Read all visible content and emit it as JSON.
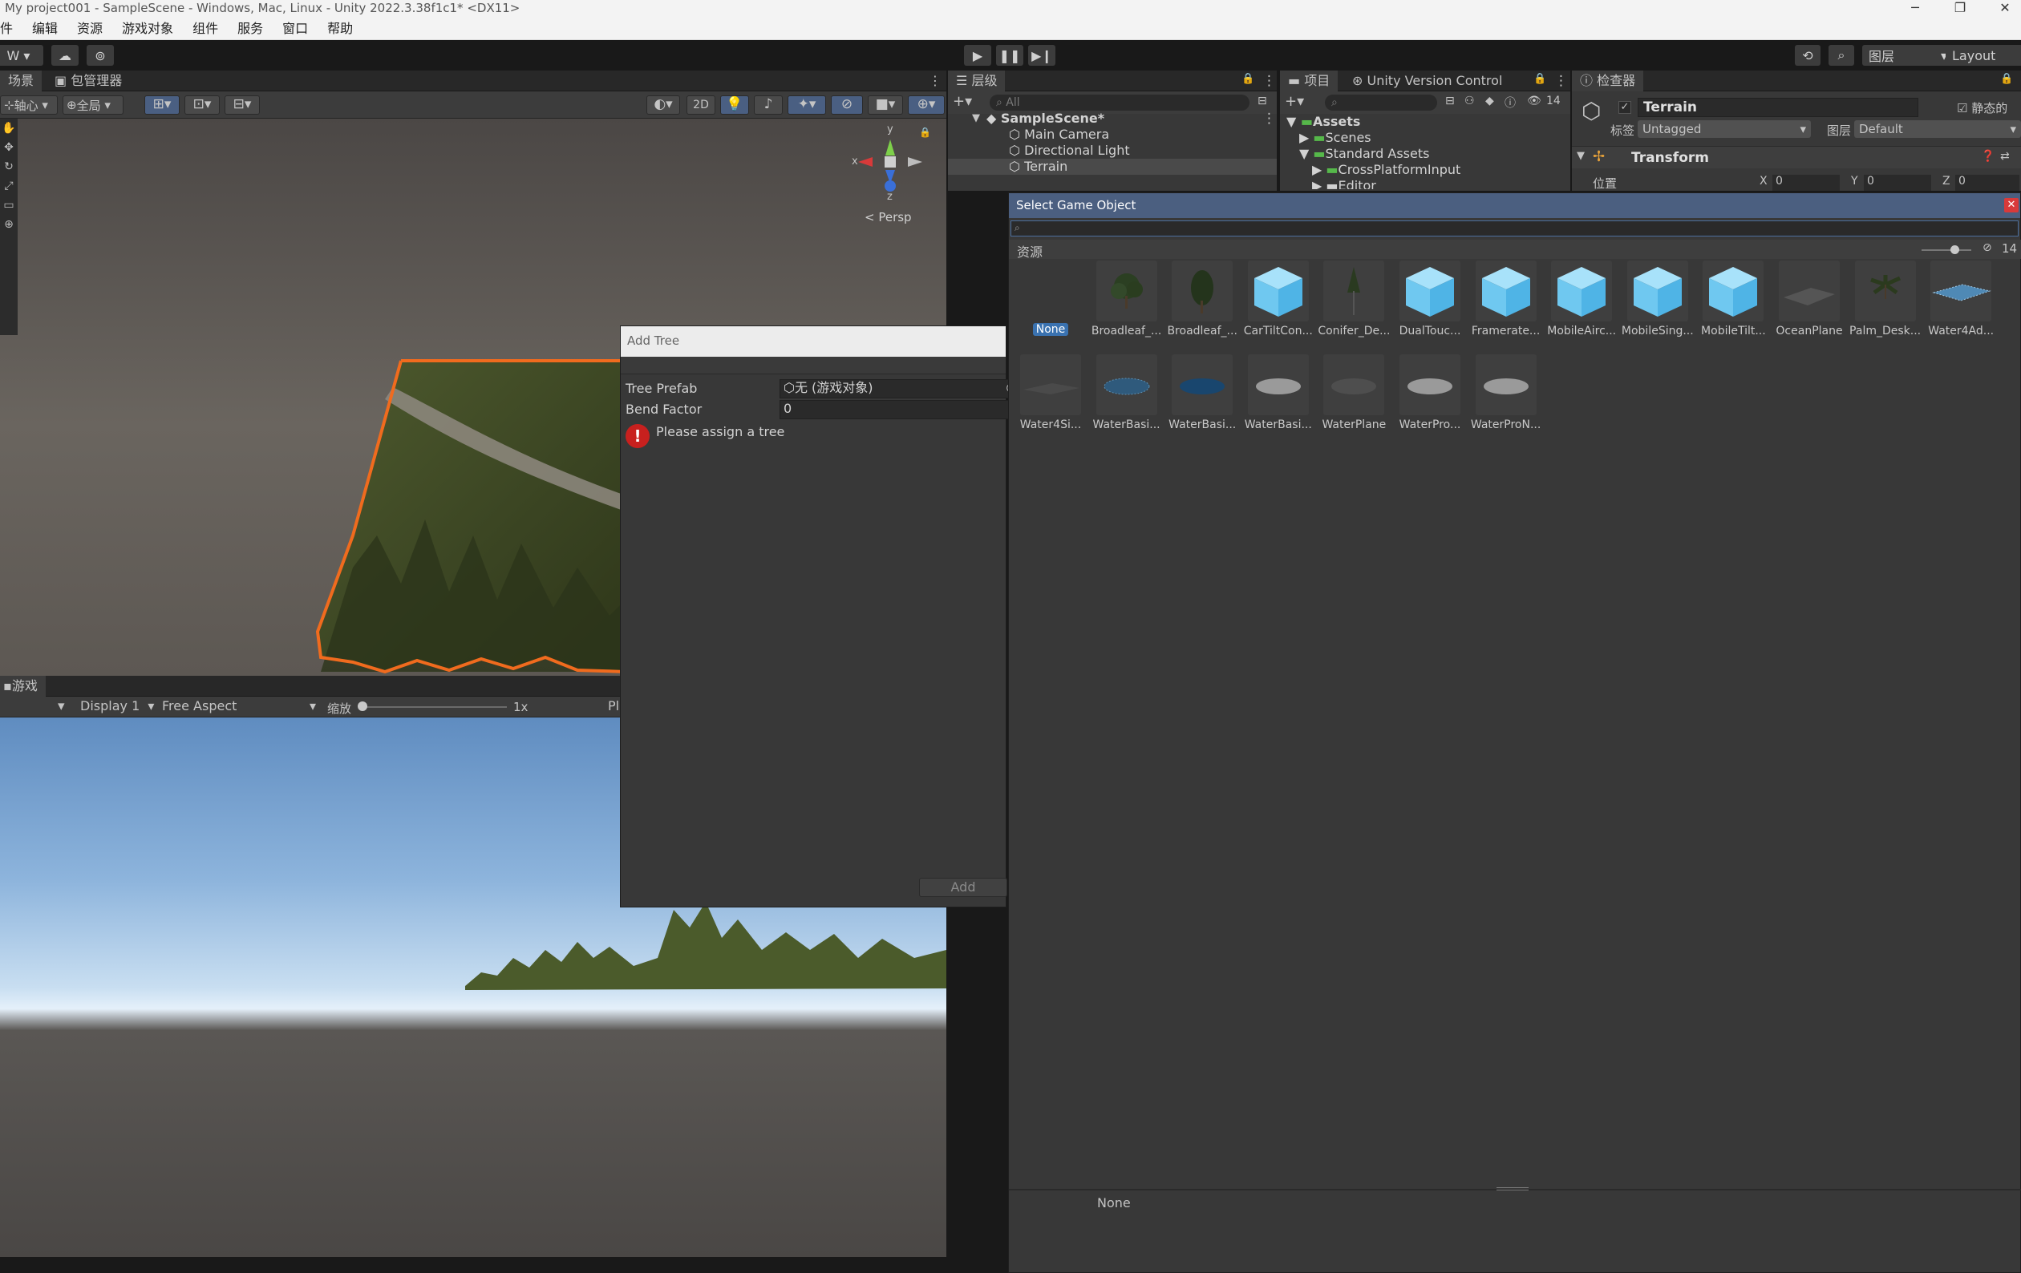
{
  "titlebar": {
    "title": "My project001 - SampleScene - Windows, Mac, Linux - Unity 2022.3.38f1c1* <DX11>"
  },
  "menu": [
    "件",
    "编辑",
    "资源",
    "游戏对象",
    "组件",
    "服务",
    "窗口",
    "帮助"
  ],
  "toolbar": {
    "account": "W",
    "layers_label": "图层",
    "layout_label": "Layout"
  },
  "scene": {
    "tabs": [
      "场景",
      "包管理器"
    ],
    "pivot_label": "轴心",
    "global_label": "全局",
    "mode_2d": "2D",
    "persp_label": "< Persp",
    "gizmo_axes": {
      "x": "x",
      "y": "y",
      "z": "z"
    }
  },
  "game": {
    "tab": "游戏",
    "display": "Display 1",
    "aspect": "Free Aspect",
    "scale_label": "缩放",
    "scale_value": "1x",
    "play_label": "Pl"
  },
  "add_tree": {
    "title": "Add Tree",
    "props": [
      {
        "label": "Tree Prefab",
        "value": "无 (游戏对象)"
      },
      {
        "label": "Bend Factor",
        "value": "0"
      }
    ],
    "warning": "Please assign a tree",
    "add_button": "Add"
  },
  "hierarchy": {
    "tab": "层级",
    "search_placeholder": "All",
    "scene": "SampleScene*",
    "items": [
      "Main Camera",
      "Directional Light",
      "Terrain"
    ]
  },
  "project": {
    "tabs": [
      "项目",
      "Unity Version Control"
    ],
    "count": "14",
    "tree": [
      "Assets",
      "Scenes",
      "Standard Assets",
      "CrossPlatformInput",
      "Editor"
    ]
  },
  "inspector": {
    "tab": "检查器",
    "object_name": "Terrain",
    "static_label": "静态的",
    "tag_label": "标签",
    "tag_value": "Untagged",
    "layer_label": "图层",
    "layer_value": "Default",
    "component": "Transform",
    "position_label": "位置",
    "axis_labels": [
      "X",
      "Y",
      "Z"
    ],
    "axis_values": [
      "0",
      "0",
      "0"
    ]
  },
  "select_go": {
    "title": "Select Game Object",
    "section_label": "资源",
    "hidden_count": "14",
    "footer_selected": "None",
    "assets": [
      {
        "name": "None",
        "kind": "none"
      },
      {
        "name": "Broadleaf_...",
        "kind": "tree"
      },
      {
        "name": "Broadleaf_...",
        "kind": "tree2"
      },
      {
        "name": "CarTiltCon...",
        "kind": "cube"
      },
      {
        "name": "Conifer_De...",
        "kind": "conifer"
      },
      {
        "name": "DualTouc...",
        "kind": "cube"
      },
      {
        "name": "Framerate...",
        "kind": "cube"
      },
      {
        "name": "MobileAirc...",
        "kind": "cube"
      },
      {
        "name": "MobileSing...",
        "kind": "cube"
      },
      {
        "name": "MobileTilt...",
        "kind": "cube"
      },
      {
        "name": "OceanPlane",
        "kind": "plane"
      },
      {
        "name": "Palm_Desk...",
        "kind": "palm"
      },
      {
        "name": "Water4Ad...",
        "kind": "water4"
      },
      {
        "name": "Water4Si...",
        "kind": "flat"
      },
      {
        "name": "WaterBasi...",
        "kind": "dotdisc"
      },
      {
        "name": "WaterBasi...",
        "kind": "bluedisc"
      },
      {
        "name": "WaterBasi...",
        "kind": "greydisc"
      },
      {
        "name": "WaterPlane",
        "kind": "darkdisc"
      },
      {
        "name": "WaterPro...",
        "kind": "greydisc"
      },
      {
        "name": "WaterProN...",
        "kind": "greydisc"
      }
    ]
  },
  "colors": {
    "selection_orange": "#f06b1e",
    "unity_blue": "#3a72b0",
    "cube_blue": "#6fc8f0",
    "error_red": "#c8201e"
  }
}
